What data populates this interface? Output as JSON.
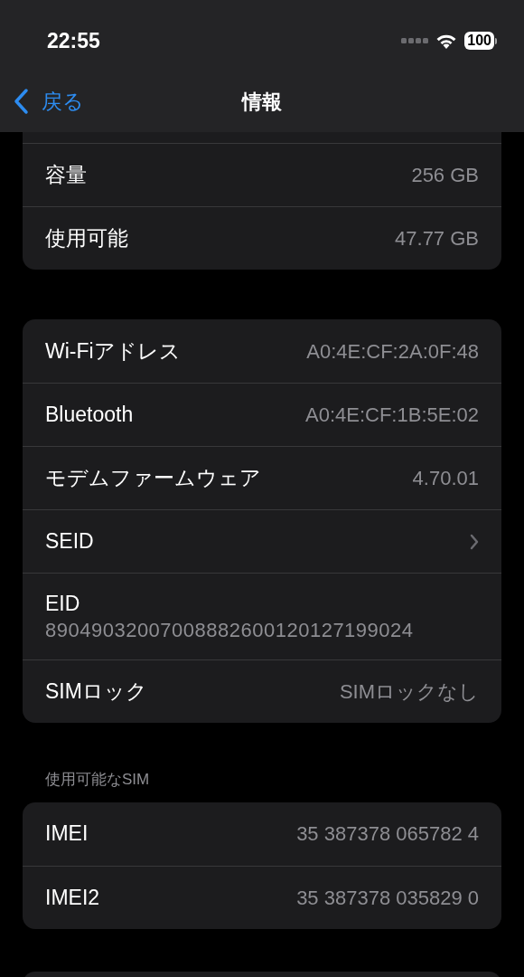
{
  "status_bar": {
    "time": "22:55",
    "battery": "100"
  },
  "nav": {
    "back": "戻る",
    "title": "情報"
  },
  "groups": [
    {
      "rows": [
        {
          "kind": "value",
          "label": "容量",
          "value": "256 GB"
        },
        {
          "kind": "value",
          "label": "使用可能",
          "value": "47.77 GB"
        }
      ]
    },
    {
      "rows": [
        {
          "kind": "value",
          "label": "Wi-Fiアドレス",
          "value": "A0:4E:CF:2A:0F:48"
        },
        {
          "kind": "value",
          "label": "Bluetooth",
          "value": "A0:4E:CF:1B:5E:02"
        },
        {
          "kind": "value",
          "label": "モデムファームウェア",
          "value": "4.70.01"
        },
        {
          "kind": "link",
          "label": "SEID"
        },
        {
          "kind": "stacked",
          "label": "EID",
          "value": "89049032007008882600120127199024"
        },
        {
          "kind": "value",
          "label": "SIMロック",
          "value": "SIMロックなし"
        }
      ]
    },
    {
      "header": "使用可能なSIM",
      "rows": [
        {
          "kind": "value",
          "label": "IMEI",
          "value": "35 387378 065782 4"
        },
        {
          "kind": "value",
          "label": "IMEI2",
          "value": "35 387378 035829 0"
        }
      ]
    }
  ]
}
